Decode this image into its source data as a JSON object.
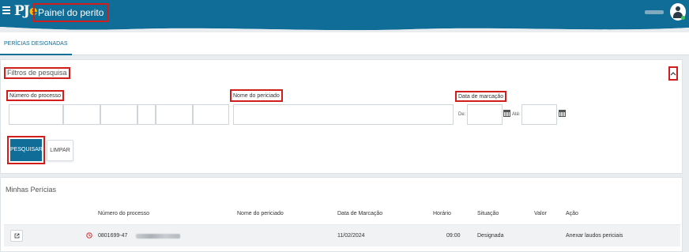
{
  "header": {
    "logo_text": "PJ",
    "logo_accent": "e",
    "title": "Painel do perito",
    "icons": [
      "menu-icon",
      "user-avatar-icon"
    ],
    "colors": {
      "bar": "#0f6d98",
      "accent": "#f5c000",
      "highlight": "#d21d1d"
    }
  },
  "tabs": [
    {
      "label": "PERÍCIAS DESIGNADAS"
    }
  ],
  "filters": {
    "title": "Filtros de pesquisa",
    "numero_label": "Número do processo",
    "nome_label": "Nome do periciado",
    "data_label": "Data de marcação",
    "de_label": "De:",
    "ate_label": "Até:",
    "search_button": "PESQUISAR",
    "clear_button": "LIMPAR"
  },
  "pericias": {
    "title": "Minhas Perícias",
    "columns": [
      "Número do processo",
      "Nome do periciado",
      "Data de Marcação",
      "Horário",
      "Situação",
      "Valor",
      "Ação"
    ],
    "rows": [
      {
        "numero": "0801699-47",
        "nome": "",
        "data": "11/02/2024",
        "horario": "09:00",
        "situacao": "Designada",
        "valor": "",
        "acao": "Anexar laudos periciais"
      }
    ]
  }
}
